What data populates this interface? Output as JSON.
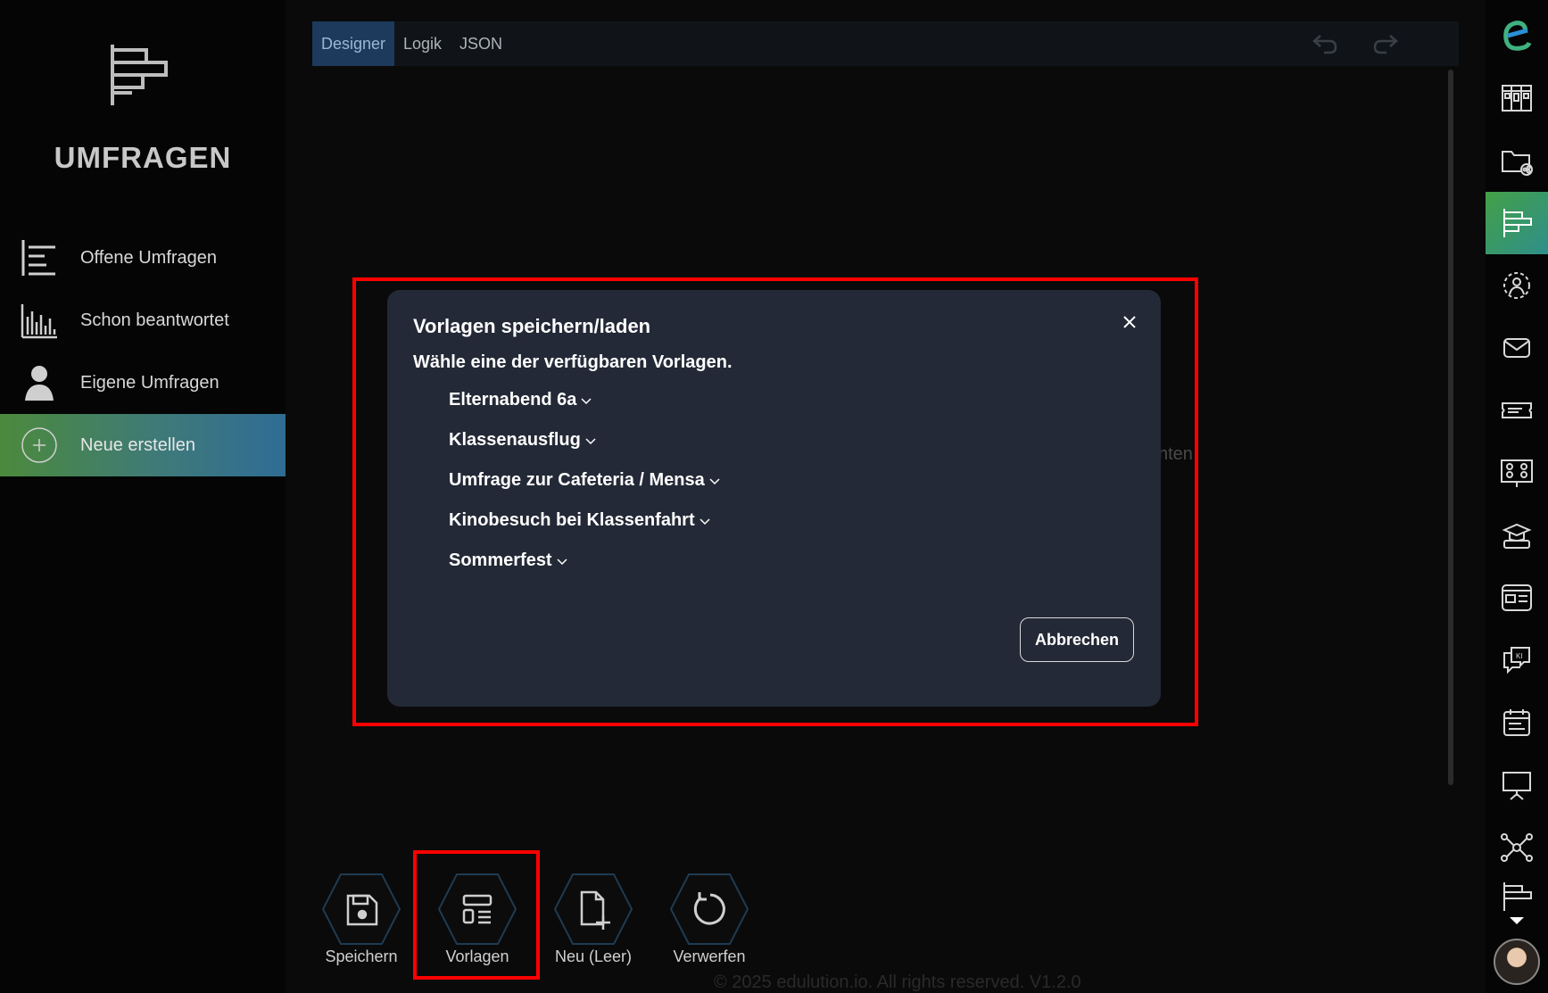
{
  "sidebar": {
    "title": "UMFRAGEN",
    "items": [
      {
        "label": "Offene Umfragen",
        "icon": "list-bars-icon"
      },
      {
        "label": "Schon beantwortet",
        "icon": "bar-chart-icon"
      },
      {
        "label": "Eigene Umfragen",
        "icon": "user-icon"
      },
      {
        "label": "Neue erstellen",
        "icon": "plus-circle-icon",
        "active": true
      }
    ]
  },
  "tabs": [
    {
      "label": "Designer",
      "active": true
    },
    {
      "label": "Logik"
    },
    {
      "label": "JSON"
    }
  ],
  "background": {
    "partial_text": "nten",
    "footer": "© 2025 edulution.io. All rights reserved. V1.2.0"
  },
  "modal": {
    "title": "Vorlagen speichern/laden",
    "subtitle": "Wähle eine der verfügbaren Vorlagen.",
    "templates": [
      "Elternabend 6a",
      "Klassenausflug",
      "Umfrage zur Cafeteria / Mensa",
      "Kinobesuch bei Klassenfahrt",
      "Sommerfest"
    ],
    "cancel_label": "Abbrechen"
  },
  "actions": [
    {
      "label": "Speichern",
      "icon": "save-icon"
    },
    {
      "label": "Vorlagen",
      "icon": "template-icon"
    },
    {
      "label": "Neu (Leer)",
      "icon": "new-file-icon"
    },
    {
      "label": "Verwerfen",
      "icon": "reset-icon"
    }
  ],
  "colors": {
    "accent_green": "#43a047",
    "accent_blue": "#1d3a5c",
    "highlight_red": "#ff0000",
    "modal_bg": "#232936"
  }
}
